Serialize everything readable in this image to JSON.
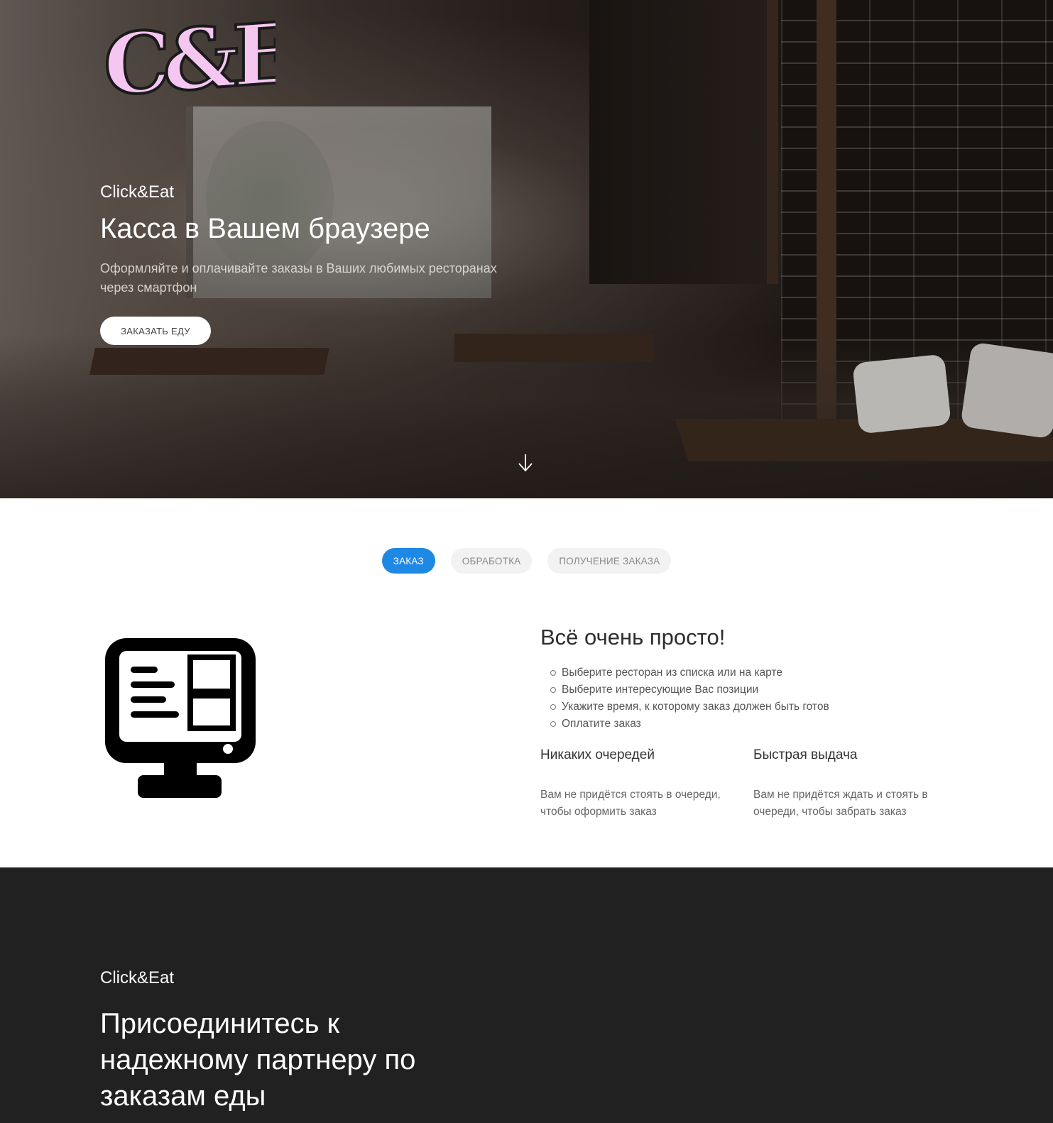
{
  "hero": {
    "logo_text": "C&E",
    "kicker": "Click&Eat",
    "title": "Касса в Вашем браузере",
    "subtitle": "Оформляйте и оплачивайте заказы в Ваших любимых ресторанах через смартфон",
    "order_button": "ЗАКАЗАТЬ ЕДУ",
    "scroll_icon": "arrow-down-icon"
  },
  "tabs": [
    {
      "label": "ЗАКАЗ",
      "active": true
    },
    {
      "label": "ОБРАБОТКА",
      "active": false
    },
    {
      "label": "ПОЛУЧЕНИЕ ЗАКАЗА",
      "active": false
    }
  ],
  "feature": {
    "icon": "kiosk-terminal-icon",
    "title": "Всё очень просто!",
    "steps": [
      "Выберите ресторан из списка или на карте",
      "Выберите интересующие Вас позиции",
      "Укажите время, к которому заказ должен быть готов",
      "Оплатите заказ"
    ],
    "columns": [
      {
        "title": "Никаких очередей",
        "text": "Вам не придётся стоять в очереди, чтобы оформить заказ"
      },
      {
        "title": "Быстрая выдача",
        "text": "Вам не придётся ждать и стоять в очереди, чтобы забрать заказ"
      }
    ]
  },
  "partner": {
    "kicker": "Click&Eat",
    "title": "Присоединитесь к надежному партнеру по заказам еды"
  },
  "colors": {
    "accent": "#1e88e5",
    "dark_section": "#212121",
    "logo_pink": "#f5c6f0"
  }
}
